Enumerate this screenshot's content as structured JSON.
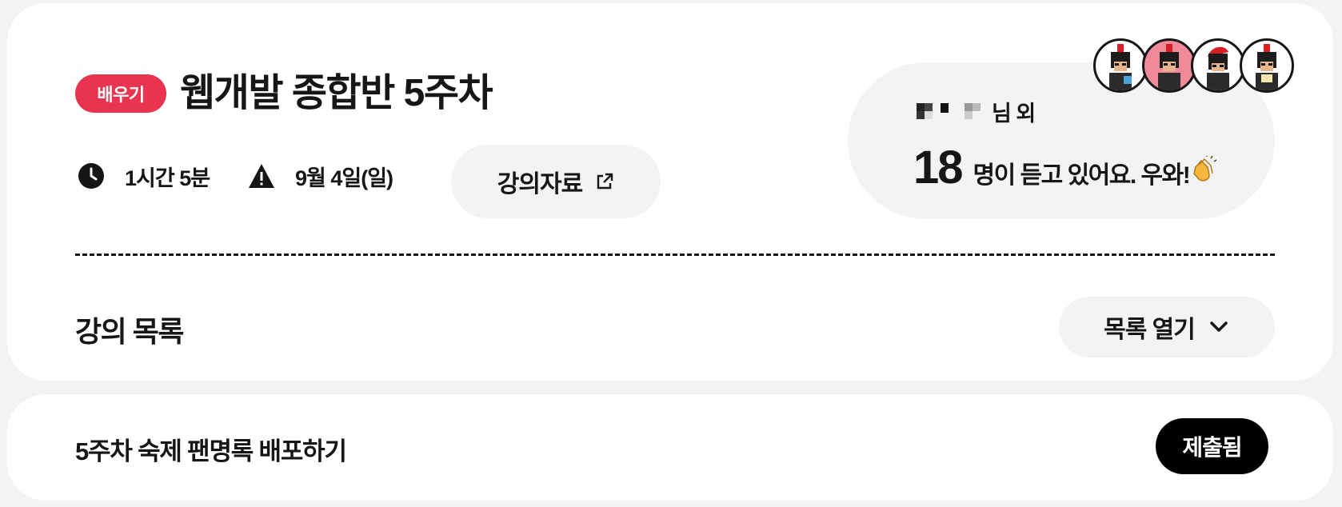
{
  "lecture": {
    "badge": "배우기",
    "title": "웹개발 종합반 5주차",
    "duration": "1시간 5분",
    "due_date": "9월 4일(일)",
    "materials_label": "강의자료"
  },
  "listeners": {
    "names_suffix": "님 외",
    "count": "18",
    "count_text": "명이 듣고 있어요. 우와!"
  },
  "lecture_list": {
    "title": "강의 목록",
    "open_label": "목록 열기"
  },
  "homework": {
    "title": "5주차 숙제 팬명록 배포하기",
    "status": "제출됨"
  },
  "colors": {
    "badge": "#e8344e",
    "surface": "#f1f3f5",
    "text": "#141617"
  },
  "icons": [
    "clock-icon",
    "warning-icon",
    "external-link-icon",
    "chevron-down-icon",
    "clap-icon",
    "avatar-icon"
  ]
}
